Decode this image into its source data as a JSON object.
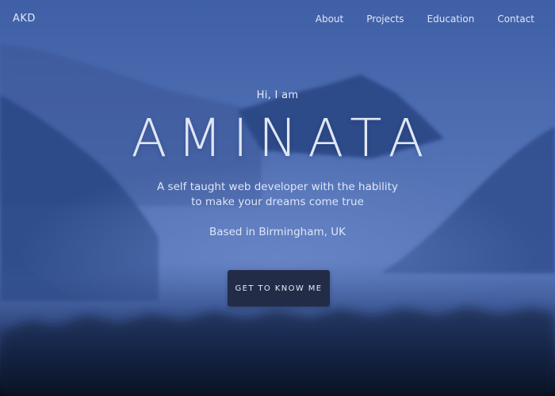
{
  "header": {
    "logo": "AKD",
    "nav": [
      {
        "label": "About"
      },
      {
        "label": "Projects"
      },
      {
        "label": "Education"
      },
      {
        "label": "Contact"
      }
    ]
  },
  "hero": {
    "greeting": "Hi, I am",
    "name": "AMINATA",
    "tagline": "A self taught web developer with the hability to make your dreams come true",
    "location": "Based in Birmingham, UK",
    "cta_label": "GET TO KNOW ME"
  },
  "colors": {
    "sky": "#4767ad",
    "mountain": "#2a4683",
    "forest_dark": "#0c1124",
    "button": "#222c47"
  }
}
